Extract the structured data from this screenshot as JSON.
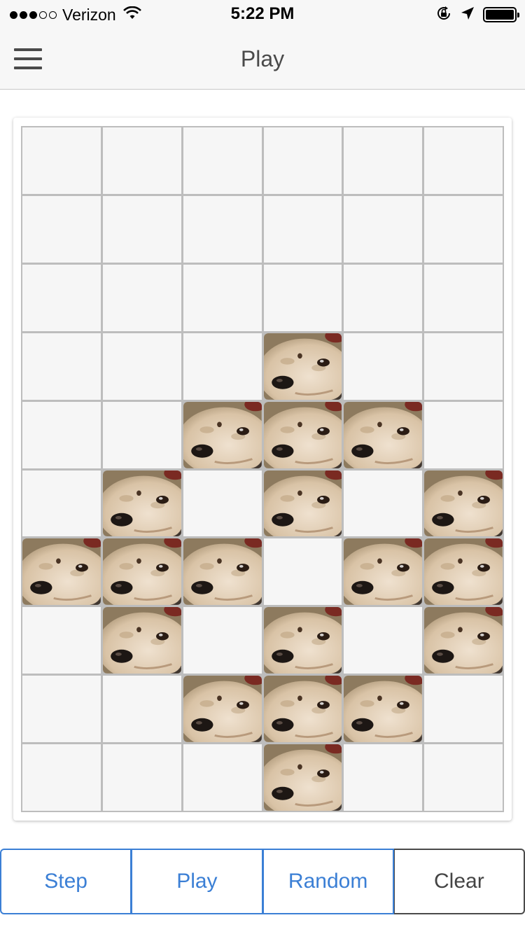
{
  "status_bar": {
    "carrier": "Verizon",
    "time": "5:22 PM",
    "signal_bars": 3,
    "signal_total": 5,
    "battery_level": 1.0
  },
  "nav": {
    "title": "Play",
    "menu_icon": "hamburger-menu-icon"
  },
  "board": {
    "columns": 6,
    "rows": 10,
    "cell_image": "dog-face-icon",
    "cells": [
      [
        0,
        0,
        0,
        0,
        0,
        0
      ],
      [
        0,
        0,
        0,
        0,
        0,
        0
      ],
      [
        0,
        0,
        0,
        0,
        0,
        0
      ],
      [
        0,
        0,
        0,
        1,
        0,
        0
      ],
      [
        0,
        0,
        1,
        1,
        1,
        0
      ],
      [
        0,
        1,
        0,
        1,
        0,
        1
      ],
      [
        1,
        1,
        1,
        0,
        1,
        1
      ],
      [
        0,
        1,
        0,
        1,
        0,
        1
      ],
      [
        0,
        0,
        1,
        1,
        1,
        0
      ],
      [
        0,
        0,
        0,
        1,
        0,
        0
      ]
    ]
  },
  "controls": {
    "step_label": "Step",
    "play_label": "Play",
    "random_label": "Random",
    "clear_label": "Clear"
  },
  "colors": {
    "accent": "#3b7fd5",
    "grid_line": "#bdbdbd",
    "cell_empty": "#f6f6f6"
  }
}
